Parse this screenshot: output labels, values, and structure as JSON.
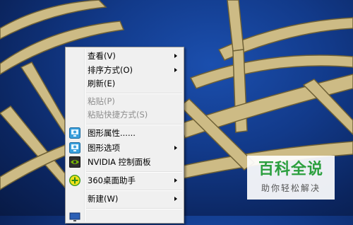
{
  "colors": {
    "sky": "#123a8a",
    "girder": "#cdbb85",
    "menu_bg": "#f0f0f0",
    "disabled_text": "#8d8d8d",
    "watermark_green": "#2b9f3e"
  },
  "context_menu": {
    "items": [
      {
        "label": "查看(V)",
        "has_submenu": true,
        "enabled": true
      },
      {
        "label": "排序方式(O)",
        "has_submenu": true,
        "enabled": true
      },
      {
        "label": "刷新(E)",
        "has_submenu": false,
        "enabled": true
      },
      {
        "label": "粘贴(P)",
        "has_submenu": false,
        "enabled": false
      },
      {
        "label": "粘贴快捷方式(S)",
        "has_submenu": false,
        "enabled": false
      },
      {
        "label": "图形属性......",
        "icon": "intel-graphics-icon",
        "has_submenu": false,
        "enabled": true
      },
      {
        "label": "图形选项",
        "icon": "intel-graphics-icon",
        "has_submenu": true,
        "enabled": true
      },
      {
        "label": "NVIDIA 控制面板",
        "icon": "nvidia-icon",
        "has_submenu": false,
        "enabled": true
      },
      {
        "label": "360桌面助手",
        "icon": "360-plus-icon",
        "has_submenu": true,
        "enabled": true
      },
      {
        "label": "新建(W)",
        "has_submenu": true,
        "enabled": true
      }
    ]
  },
  "watermark": {
    "title": "百科全说",
    "subtitle": "助你轻松解决"
  }
}
